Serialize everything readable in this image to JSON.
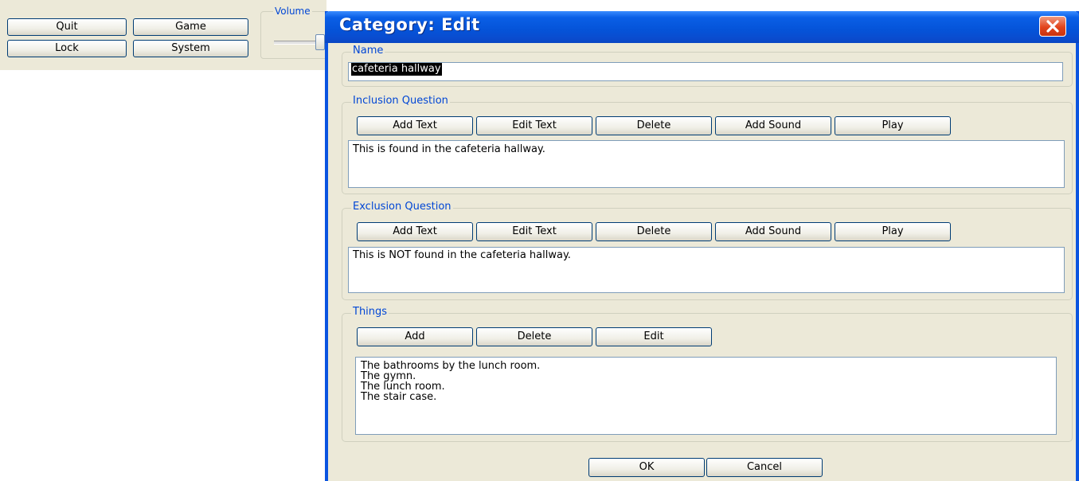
{
  "toolbar": {
    "quit_label": "Quit",
    "game_label": "Game",
    "lock_label": "Lock",
    "system_label": "System",
    "volume_label": "Volume"
  },
  "dialog": {
    "title": "Category: Edit",
    "name": {
      "label": "Name",
      "value": "cafeteria hallway"
    },
    "inclusion": {
      "label": "Inclusion Question",
      "buttons": [
        "Add Text",
        "Edit Text",
        "Delete",
        "Add Sound",
        "Play"
      ],
      "text": "This is found in the cafeteria hallway."
    },
    "exclusion": {
      "label": "Exclusion Question",
      "buttons": [
        "Add Text",
        "Edit Text",
        "Delete",
        "Add Sound",
        "Play"
      ],
      "text": "This is NOT found in the cafeteria hallway."
    },
    "things": {
      "label": "Things",
      "buttons": [
        "Add",
        "Delete",
        "Edit"
      ],
      "items": [
        "The bathrooms by the lunch room.",
        "The gymn.",
        "The lunch room.",
        "The stair case."
      ]
    },
    "ok_label": "OK",
    "cancel_label": "Cancel"
  },
  "colors": {
    "titlebar": "#0553d8",
    "group_label": "#0046d5",
    "face": "#ece9d8"
  }
}
